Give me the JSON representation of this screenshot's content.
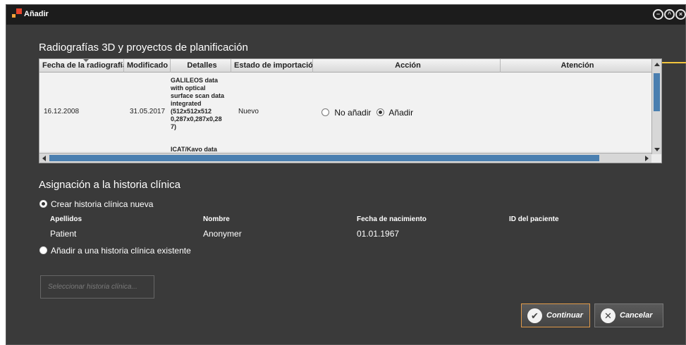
{
  "window": {
    "title": "Añadir",
    "controls": [
      "minimize-icon",
      "restore-icon",
      "close-icon"
    ]
  },
  "volumes_section": {
    "title": "Radiografías 3D y proyectos de planificación",
    "columns": [
      "Fecha de la radiografía",
      "Modificado el",
      "Detalles",
      "Estado de importación",
      "Acción",
      "Atención"
    ],
    "row": {
      "date": "16.12.2008",
      "modified": "31.05.2017",
      "details": "GALILEOS data with optical surface scan data integrated (512x512x512 0,287x0,287x0,287)",
      "details_line1": "GALILEOS data",
      "details_line2": "with optical",
      "details_line3": "surface scan data",
      "details_line4": "integrated",
      "details_line5": "(512x512x512",
      "details_line6": "0,287x0,287x0,28",
      "details_line7": "7)",
      "details_next": "ICAT/Kavo data",
      "status": "Nuevo",
      "action_no": "No añadir",
      "action_yes": "Añadir",
      "action_selected": "Añadir"
    }
  },
  "patient_section": {
    "title": "Asignación a la historia clínica",
    "option_new": "Crear historia clínica nueva",
    "option_existing": "Añadir a una historia clínica existente",
    "selected_option": "Crear historia clínica nueva",
    "labels": {
      "last_name": "Apellidos",
      "first_name": "Nombre",
      "birth_date": "Fecha de nacimiento",
      "patient_id": "ID del paciente"
    },
    "values": {
      "last_name": "Patient",
      "first_name": "Anonymer",
      "birth_date": "01.01.1967",
      "patient_id": ""
    },
    "select_button": "Seleccionar historia clínica..."
  },
  "buttons": {
    "continue": "Continuar",
    "cancel": "Cancelar"
  },
  "colors": {
    "window_bg": "#3a3a3a",
    "titlebar_bg": "#1c1c1c",
    "callout": "#f2c53d",
    "scroll_thumb": "#4a7fb0",
    "primary_border": "#e09a4a"
  }
}
